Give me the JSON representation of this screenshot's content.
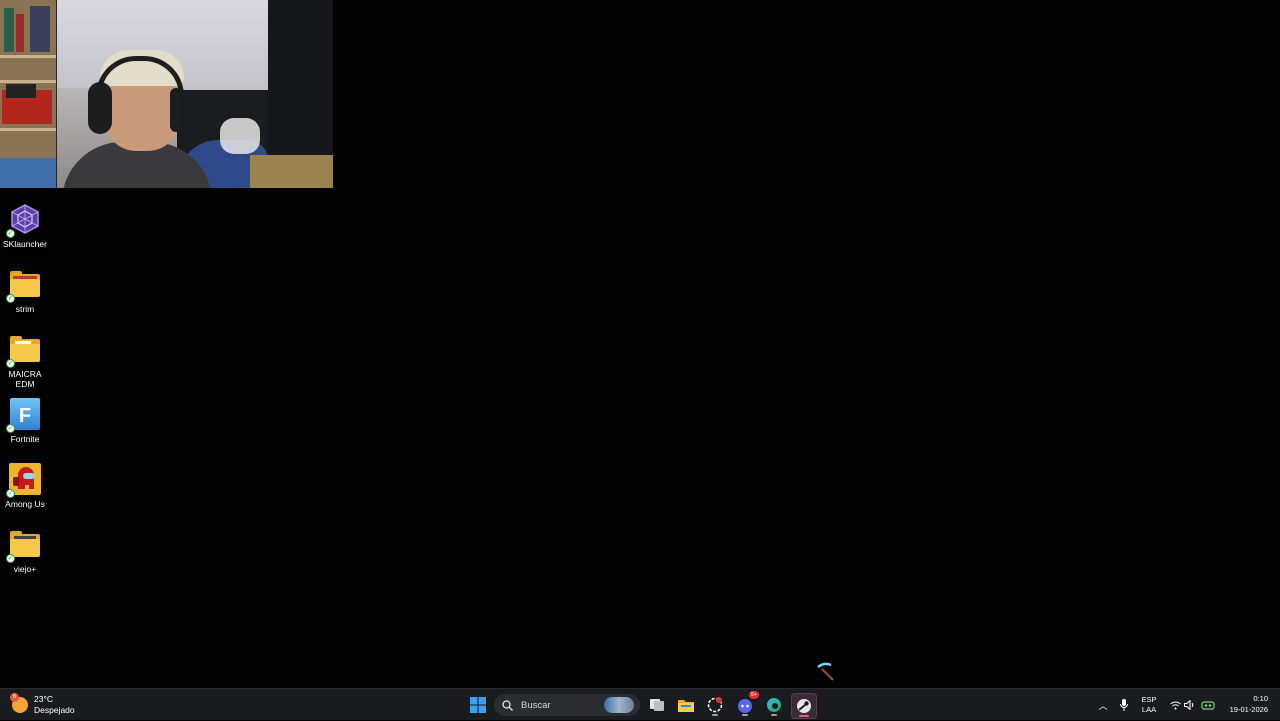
{
  "desktop": {
    "icons": [
      {
        "label": "SKlauncher",
        "icon": "sklauncher-icon"
      },
      {
        "label": "strim",
        "icon": "folder-icon"
      },
      {
        "label": "MAICRA EDM",
        "icon": "folder-icon"
      },
      {
        "label": "Fortnite",
        "icon": "fortnite-icon"
      },
      {
        "label": "Among Us",
        "icon": "among-us-icon"
      },
      {
        "label": "viejo+",
        "icon": "folder-icon"
      }
    ]
  },
  "webcam": {
    "icon": "webcam-feed"
  },
  "taskbar": {
    "weather": {
      "temp": "23°C",
      "condition": "Despejado",
      "badge": "6"
    },
    "search": {
      "placeholder": "Buscar"
    },
    "apps": [
      "start-icon",
      "task-view-icon",
      "file-explorer-icon",
      "screen-recorder-icon",
      "discord-icon",
      "edge-icon",
      "steam-icon"
    ],
    "discord_badge": "9+",
    "tray": {
      "language_top": "ESP",
      "language_bottom": "LAA"
    },
    "clock": {
      "time": "0:10",
      "date": "19-01-2026"
    }
  },
  "colors": {
    "taskbar": "#1a1b1f",
    "desktop": "#020203",
    "accent": "#0078d4",
    "folder": "#f5c84a"
  }
}
